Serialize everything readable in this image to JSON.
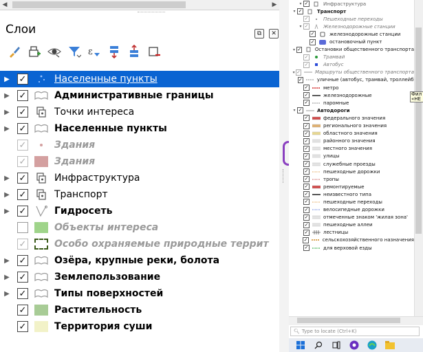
{
  "panel": {
    "title": "Слои",
    "float_btn": "⧉",
    "close_btn": "✕"
  },
  "toolbar": {
    "icons": [
      "style-brush-icon",
      "add-group-icon",
      "eye-icon",
      "filter-icon",
      "expression-filter-icon",
      "expand-all-icon",
      "collapse-all-icon",
      "remove-layer-icon"
    ]
  },
  "layers": [
    {
      "label": "Населенные пункты",
      "checked": true,
      "expandable": true,
      "style": "selected",
      "icon": "points"
    },
    {
      "label": "Административные границы",
      "checked": true,
      "expandable": true,
      "style": "bold",
      "icon": "group"
    },
    {
      "label": "Точки интереса",
      "checked": true,
      "expandable": true,
      "style": "normal",
      "icon": "point-group"
    },
    {
      "label": "Населенные пункты",
      "checked": true,
      "expandable": true,
      "style": "bold",
      "icon": "group"
    },
    {
      "label": "Здания",
      "checked": true,
      "expandable": false,
      "style": "italic",
      "icon": "dot",
      "dim": true
    },
    {
      "label": "Здания",
      "checked": true,
      "expandable": false,
      "style": "italic",
      "icon": "swatch",
      "color": "#d4a0a0",
      "dim": true
    },
    {
      "label": "Инфраструктура",
      "checked": true,
      "expandable": true,
      "style": "normal",
      "icon": "point-group"
    },
    {
      "label": "Транспорт",
      "checked": true,
      "expandable": true,
      "style": "normal",
      "icon": "point-group"
    },
    {
      "label": "Гидросеть",
      "checked": true,
      "expandable": true,
      "style": "bold",
      "icon": "line"
    },
    {
      "label": "Объекты интереса",
      "checked": false,
      "expandable": false,
      "style": "italic",
      "icon": "swatch",
      "color": "#9fd48a"
    },
    {
      "label": "Особо охраняемые природные террит",
      "checked": true,
      "expandable": false,
      "style": "italic",
      "icon": "dashed",
      "dim": true
    },
    {
      "label": "Озёра, крупные реки, болота",
      "checked": true,
      "expandable": true,
      "style": "bold",
      "icon": "group"
    },
    {
      "label": "Землепользование",
      "checked": true,
      "expandable": true,
      "style": "bold",
      "icon": "group"
    },
    {
      "label": "Типы поверхностей",
      "checked": true,
      "expandable": true,
      "style": "bold",
      "icon": "group"
    },
    {
      "label": "Растительность",
      "checked": true,
      "expandable": false,
      "style": "bold",
      "icon": "swatch",
      "color": "#a8cc96"
    },
    {
      "label": "Территория суши",
      "checked": true,
      "expandable": false,
      "style": "bold",
      "icon": "swatch",
      "color": "#f2f2c8"
    }
  ],
  "right_tree": [
    {
      "lvl": 1,
      "exp": "▾",
      "chk": "✓",
      "sym": "pin",
      "text": "Инфраструктура",
      "st": "f"
    },
    {
      "lvl": 0,
      "exp": "▾",
      "chk": "✓",
      "sym": "pin",
      "text": "Транспорт",
      "st": "b"
    },
    {
      "lvl": 1,
      "exp": "",
      "chk": "✓",
      "sym": "tinydot",
      "text": "Пешеходные переходы",
      "st": "i"
    },
    {
      "lvl": 1,
      "exp": "▾",
      "chk": "✓",
      "sym": "pin-gray",
      "text": "Железнодорожные станции",
      "st": "i"
    },
    {
      "lvl": 2,
      "exp": "",
      "chk": "✓",
      "sym": "train",
      "text": "железнодорожные станции",
      "st": ""
    },
    {
      "lvl": 2,
      "exp": "",
      "chk": "✓",
      "sym": "bus",
      "text": "остановочный пункт",
      "st": ""
    },
    {
      "lvl": 0,
      "exp": "▾",
      "chk": "✓",
      "sym": "pin",
      "text": "Остановки общественного транспорта",
      "st": ""
    },
    {
      "lvl": 1,
      "exp": "",
      "chk": "✓",
      "sym": "greendot",
      "text": "Трамвай",
      "st": "i"
    },
    {
      "lvl": 1,
      "exp": "",
      "chk": "✓",
      "sym": "bluedot",
      "text": "Автобус",
      "st": "i"
    },
    {
      "lvl": 0,
      "exp": "▾",
      "chk": "✓",
      "sym": "line-gray",
      "text": "Маршруты общественного транспорта",
      "st": "i"
    },
    {
      "lvl": 1,
      "exp": "",
      "chk": "✓",
      "sym": "dash-gray",
      "text": "уличные (автобус, трамвай, троллейбус)",
      "st": ""
    },
    {
      "lvl": 1,
      "exp": "",
      "chk": "✓",
      "sym": "dash-red",
      "text": "метро",
      "st": ""
    },
    {
      "lvl": 1,
      "exp": "",
      "chk": "✓",
      "sym": "line-black",
      "text": "железнодорожные",
      "st": ""
    },
    {
      "lvl": 1,
      "exp": "",
      "chk": "✓",
      "sym": "dash-gray",
      "text": "паромные",
      "st": ""
    },
    {
      "lvl": 0,
      "exp": "▾",
      "chk": "✓",
      "sym": "line-gray",
      "text": "Автодороги",
      "st": "b"
    },
    {
      "lvl": 1,
      "exp": "",
      "chk": "✓",
      "sym": "road-red",
      "text": "федерального значения",
      "st": ""
    },
    {
      "lvl": 1,
      "exp": "",
      "chk": "✓",
      "sym": "road-orange",
      "text": "регионального значения",
      "st": ""
    },
    {
      "lvl": 1,
      "exp": "",
      "chk": "✓",
      "sym": "road-yellow",
      "text": "областного значения",
      "st": ""
    },
    {
      "lvl": 1,
      "exp": "",
      "chk": "✓",
      "sym": "road-gray",
      "text": "районного значения",
      "st": ""
    },
    {
      "lvl": 1,
      "exp": "",
      "chk": "✓",
      "sym": "road-gray",
      "text": "местного значения",
      "st": ""
    },
    {
      "lvl": 1,
      "exp": "",
      "chk": "✓",
      "sym": "road-gray",
      "text": "улицы",
      "st": ""
    },
    {
      "lvl": 1,
      "exp": "",
      "chk": "✓",
      "sym": "road-gray",
      "text": "служебные проезды",
      "st": ""
    },
    {
      "lvl": 1,
      "exp": "",
      "chk": "✓",
      "sym": "dot-orange",
      "text": "пешеходные дорожки",
      "st": ""
    },
    {
      "lvl": 1,
      "exp": "",
      "chk": "✓",
      "sym": "dot-red",
      "text": "тропы",
      "st": ""
    },
    {
      "lvl": 1,
      "exp": "",
      "chk": "✓",
      "sym": "road-red",
      "text": "ремонтируемые",
      "st": ""
    },
    {
      "lvl": 1,
      "exp": "",
      "chk": "✓",
      "sym": "line-darkgray",
      "text": "неизвестного типа",
      "st": ""
    },
    {
      "lvl": 1,
      "exp": "",
      "chk": "✓",
      "sym": "dot-orange",
      "text": "пешеходные переходы",
      "st": ""
    },
    {
      "lvl": 1,
      "exp": "",
      "chk": "✓",
      "sym": "dot-blue",
      "text": "велосипедные дорожки",
      "st": ""
    },
    {
      "lvl": 1,
      "exp": "",
      "chk": "✓",
      "sym": "road-gray",
      "text": "отмеченные знаком 'жилая зона'",
      "st": ""
    },
    {
      "lvl": 1,
      "exp": "",
      "chk": "✓",
      "sym": "road-gray",
      "text": "пешеходные аллеи",
      "st": ""
    },
    {
      "lvl": 1,
      "exp": "",
      "chk": "✓",
      "sym": "ladder",
      "text": "лестницы",
      "st": ""
    },
    {
      "lvl": 1,
      "exp": "",
      "chk": "✓",
      "sym": "dash-orange",
      "text": "сельскохозяйственного назначения",
      "st": ""
    },
    {
      "lvl": 1,
      "exp": "",
      "chk": "✓",
      "sym": "dot-green",
      "text": "для верховой езды",
      "st": ""
    }
  ],
  "locate_placeholder": "Type to locate (Ctrl+K)",
  "tooltip_text": "Фил «НЕ",
  "taskbar": [
    "windows-start-icon",
    "search-icon",
    "task-view-icon",
    "app-icon",
    "edge-icon",
    "explorer-icon"
  ],
  "colors": {
    "selection": "#0a64d2",
    "accent": "#8a3fc0"
  }
}
